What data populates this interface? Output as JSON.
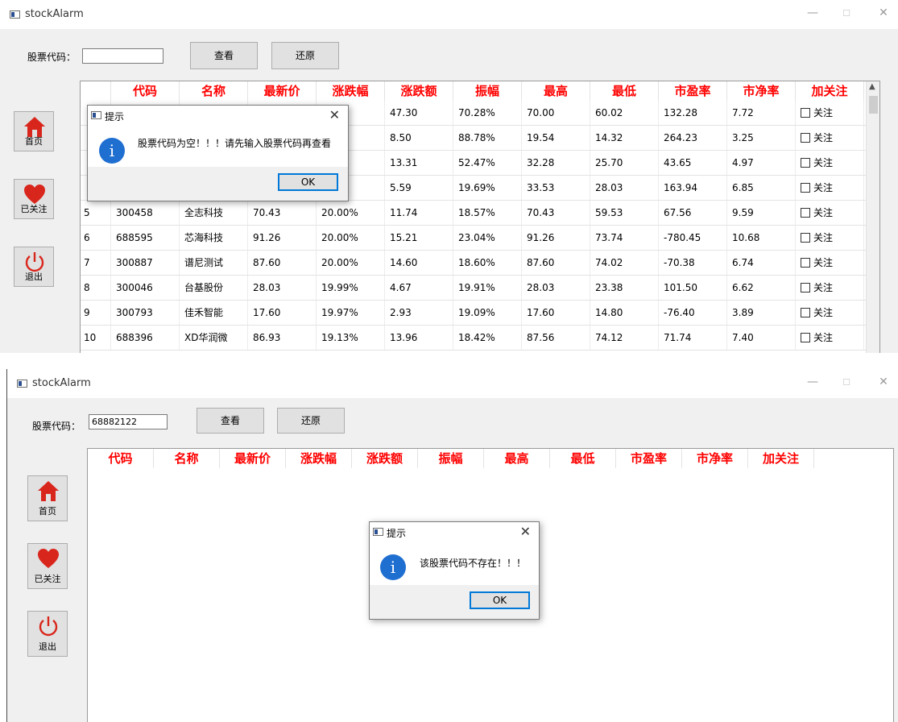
{
  "window_title": "stockAlarm",
  "controls": {
    "minimize": "—",
    "maximize": "☐",
    "close": "✕"
  },
  "code_label": "股票代码：",
  "buttons": {
    "view": "查看",
    "reset": "还原"
  },
  "sidebar": [
    {
      "label": "首页",
      "icon": "home-icon"
    },
    {
      "label": "已关注",
      "icon": "heart-icon"
    },
    {
      "label": "退出",
      "icon": "power-icon"
    }
  ],
  "colors": {
    "header_red": "#ff0000",
    "icon_red": "#d9261c",
    "info_blue": "#1f6fd1",
    "ok_border": "#0078d7"
  },
  "table_columns": [
    "代码",
    "名称",
    "最新价",
    "涨跌幅",
    "涨跌额",
    "振幅",
    "最高",
    "最低",
    "市盈率",
    "市净率",
    "加关注"
  ],
  "screen1": {
    "input_value": "",
    "rows": [
      {
        "idx": "",
        "code": "",
        "name": "",
        "price": "",
        "pct": "%",
        "chg": "47.30",
        "amp": "70.28%",
        "high": "70.00",
        "low": "60.02",
        "pe": "132.28",
        "pb": "7.72",
        "follow": "关注"
      },
      {
        "idx": "",
        "code": "",
        "name": "",
        "price": "",
        "pct": "%",
        "chg": "8.50",
        "amp": "88.78%",
        "high": "19.54",
        "low": "14.32",
        "pe": "264.23",
        "pb": "3.25",
        "follow": "关注"
      },
      {
        "idx": "",
        "code": "",
        "name": "",
        "price": "",
        "pct": "%",
        "chg": "13.31",
        "amp": "52.47%",
        "high": "32.28",
        "low": "25.70",
        "pe": "43.65",
        "pb": "4.97",
        "follow": "关注"
      },
      {
        "idx": "",
        "code": "",
        "name": "",
        "price": "",
        "pct": "%",
        "chg": "5.59",
        "amp": "19.69%",
        "high": "33.53",
        "low": "28.03",
        "pe": "163.94",
        "pb": "6.85",
        "follow": "关注"
      },
      {
        "idx": "5",
        "code": "300458",
        "name": "全志科技",
        "price": "70.43",
        "pct": "20.00%",
        "chg": "11.74",
        "amp": "18.57%",
        "high": "70.43",
        "low": "59.53",
        "pe": "67.56",
        "pb": "9.59",
        "follow": "关注"
      },
      {
        "idx": "6",
        "code": "688595",
        "name": "芯海科技",
        "price": "91.26",
        "pct": "20.00%",
        "chg": "15.21",
        "amp": "23.04%",
        "high": "91.26",
        "low": "73.74",
        "pe": "-780.45",
        "pb": "10.68",
        "follow": "关注"
      },
      {
        "idx": "7",
        "code": "300887",
        "name": "谱尼测试",
        "price": "87.60",
        "pct": "20.00%",
        "chg": "14.60",
        "amp": "18.60%",
        "high": "87.60",
        "low": "74.02",
        "pe": "-70.38",
        "pb": "6.74",
        "follow": "关注"
      },
      {
        "idx": "8",
        "code": "300046",
        "name": "台基股份",
        "price": "28.03",
        "pct": "19.99%",
        "chg": "4.67",
        "amp": "19.91%",
        "high": "28.03",
        "low": "23.38",
        "pe": "101.50",
        "pb": "6.62",
        "follow": "关注"
      },
      {
        "idx": "9",
        "code": "300793",
        "name": "佳禾智能",
        "price": "17.60",
        "pct": "19.97%",
        "chg": "2.93",
        "amp": "19.09%",
        "high": "17.60",
        "low": "14.80",
        "pe": "-76.40",
        "pb": "3.89",
        "follow": "关注"
      },
      {
        "idx": "10",
        "code": "688396",
        "name": "XD华润微",
        "price": "86.93",
        "pct": "19.13%",
        "chg": "13.96",
        "amp": "18.42%",
        "high": "87.56",
        "low": "74.12",
        "pe": "71.74",
        "pb": "7.40",
        "follow": "关注"
      }
    ],
    "dialog": {
      "title": "提示",
      "icon": "info-icon",
      "message": "股票代码为空！！！请先输入股票代码再查看",
      "ok": "OK"
    }
  },
  "screen2": {
    "input_value": "68882122",
    "dialog": {
      "title": "提示",
      "icon": "info-icon",
      "message": "该股票代码不存在！！！",
      "ok": "OK"
    }
  }
}
